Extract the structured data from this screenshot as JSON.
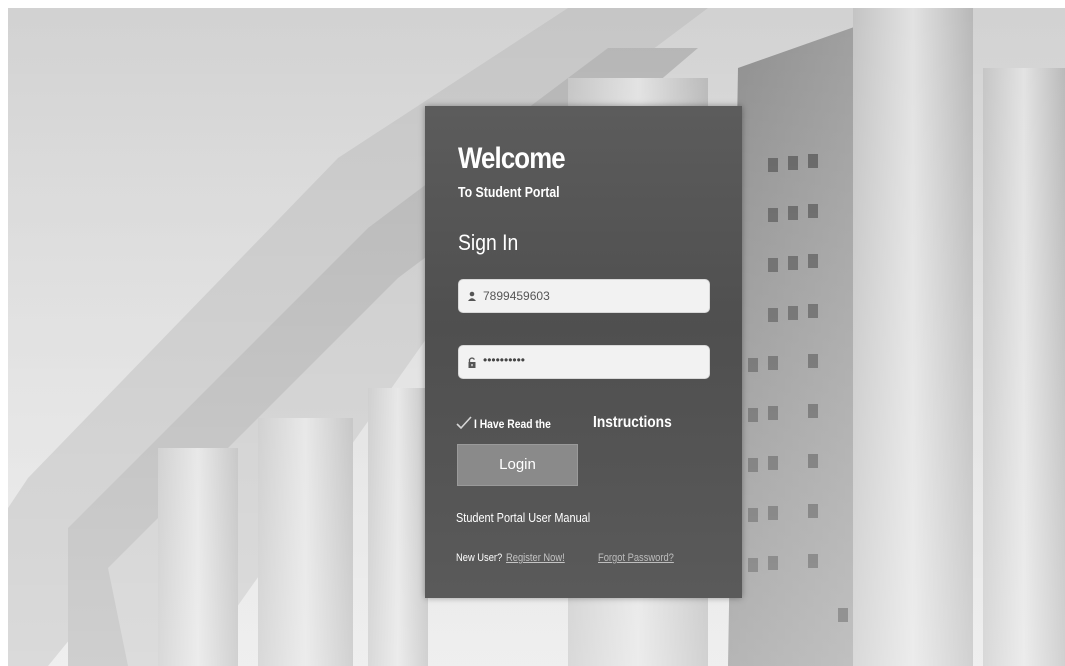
{
  "header": {
    "welcome": "Welcome",
    "subtitle": "To Student Portal"
  },
  "form": {
    "heading": "Sign In",
    "username": {
      "value": "7899459603",
      "icon": "user-icon"
    },
    "password": {
      "value": "••••••••••",
      "icon": "lock-icon"
    },
    "consent": {
      "checked": true,
      "prefix": "I Have Read the",
      "link": "Instructions"
    },
    "login_label": "Login"
  },
  "links": {
    "manual": "Student Portal User Manual",
    "new_user": "New User?",
    "register": "Register Now!",
    "forgot": "Forgot Password?"
  },
  "colors": {
    "card": "#555555",
    "button": "#8a8a8a",
    "field": "#f2f2f2"
  }
}
